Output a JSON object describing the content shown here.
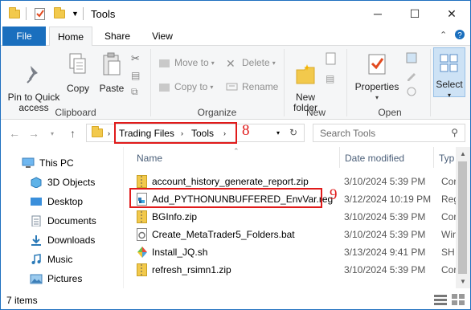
{
  "window": {
    "title": "Tools",
    "minimize": "─",
    "maximize": "☐",
    "close": "✕"
  },
  "tabs": {
    "file": "File",
    "home": "Home",
    "share": "Share",
    "view": "View"
  },
  "ribbon": {
    "pin_label": "Pin to Quick\naccess",
    "copy_label": "Copy",
    "paste_label": "Paste",
    "clipboard_group": "Clipboard",
    "move_to": "Move to",
    "copy_to": "Copy to",
    "delete": "Delete",
    "rename": "Rename",
    "organize_group": "Organize",
    "new_folder": "New\nfolder",
    "new_group": "New",
    "properties": "Properties",
    "open_group": "Open",
    "select": "Select"
  },
  "nav": {
    "crumbs": [
      "Trading Files",
      "Tools"
    ],
    "search_placeholder": "Search Tools"
  },
  "annotations": {
    "address": "8",
    "file": "9"
  },
  "tree": [
    {
      "label": "This PC",
      "icon": "monitor-icon"
    },
    {
      "label": "3D Objects",
      "icon": "cube-icon"
    },
    {
      "label": "Desktop",
      "icon": "desktop-icon"
    },
    {
      "label": "Documents",
      "icon": "documents-icon"
    },
    {
      "label": "Downloads",
      "icon": "download-icon"
    },
    {
      "label": "Music",
      "icon": "music-icon"
    },
    {
      "label": "Pictures",
      "icon": "pictures-icon"
    }
  ],
  "columns": {
    "name": "Name",
    "date": "Date modified",
    "type": "Typ"
  },
  "files": [
    {
      "name": "account_history_generate_report.zip",
      "date": "3/10/2024 5:39 PM",
      "type": "Cor",
      "icon": "zip-icon"
    },
    {
      "name": "Add_PYTHONUNBUFFERED_EnvVar.reg",
      "date": "3/12/2024 10:19 PM",
      "type": "Reg",
      "icon": "registry-icon"
    },
    {
      "name": "BGInfo.zip",
      "date": "3/10/2024 5:39 PM",
      "type": "Cor",
      "icon": "zip-icon"
    },
    {
      "name": "Create_MetaTrader5_Folders.bat",
      "date": "3/10/2024 5:39 PM",
      "type": "Wir",
      "icon": "batch-icon"
    },
    {
      "name": "Install_JQ.sh",
      "date": "3/13/2024 9:41 PM",
      "type": "SH",
      "icon": "script-icon"
    },
    {
      "name": "refresh_rsimn1.zip",
      "date": "3/10/2024 5:39 PM",
      "type": "Cor",
      "icon": "zip-icon"
    }
  ],
  "status": {
    "items": "7 items"
  }
}
